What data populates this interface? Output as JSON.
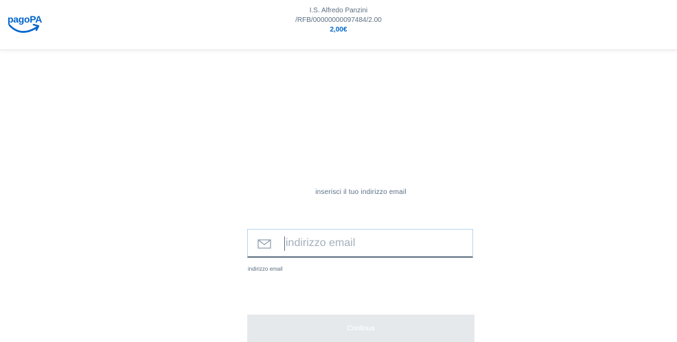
{
  "header": {
    "logo_text": "pagoPA",
    "payee": "I.S. Alfredo Panzini",
    "notice_code": "/RFB/00000000097484/2.00",
    "amount": "2,00€"
  },
  "form": {
    "prompt": "inserisci il tuo indirizzo email",
    "email": {
      "value": "",
      "placeholder": "indirizzo email",
      "icon": "mail-icon",
      "label": "indirizzo email"
    },
    "continue_label": "Continua"
  },
  "colors": {
    "brand": "#0066cc",
    "text": "#5c6f82",
    "button_disabled": "#e6e9ec"
  }
}
